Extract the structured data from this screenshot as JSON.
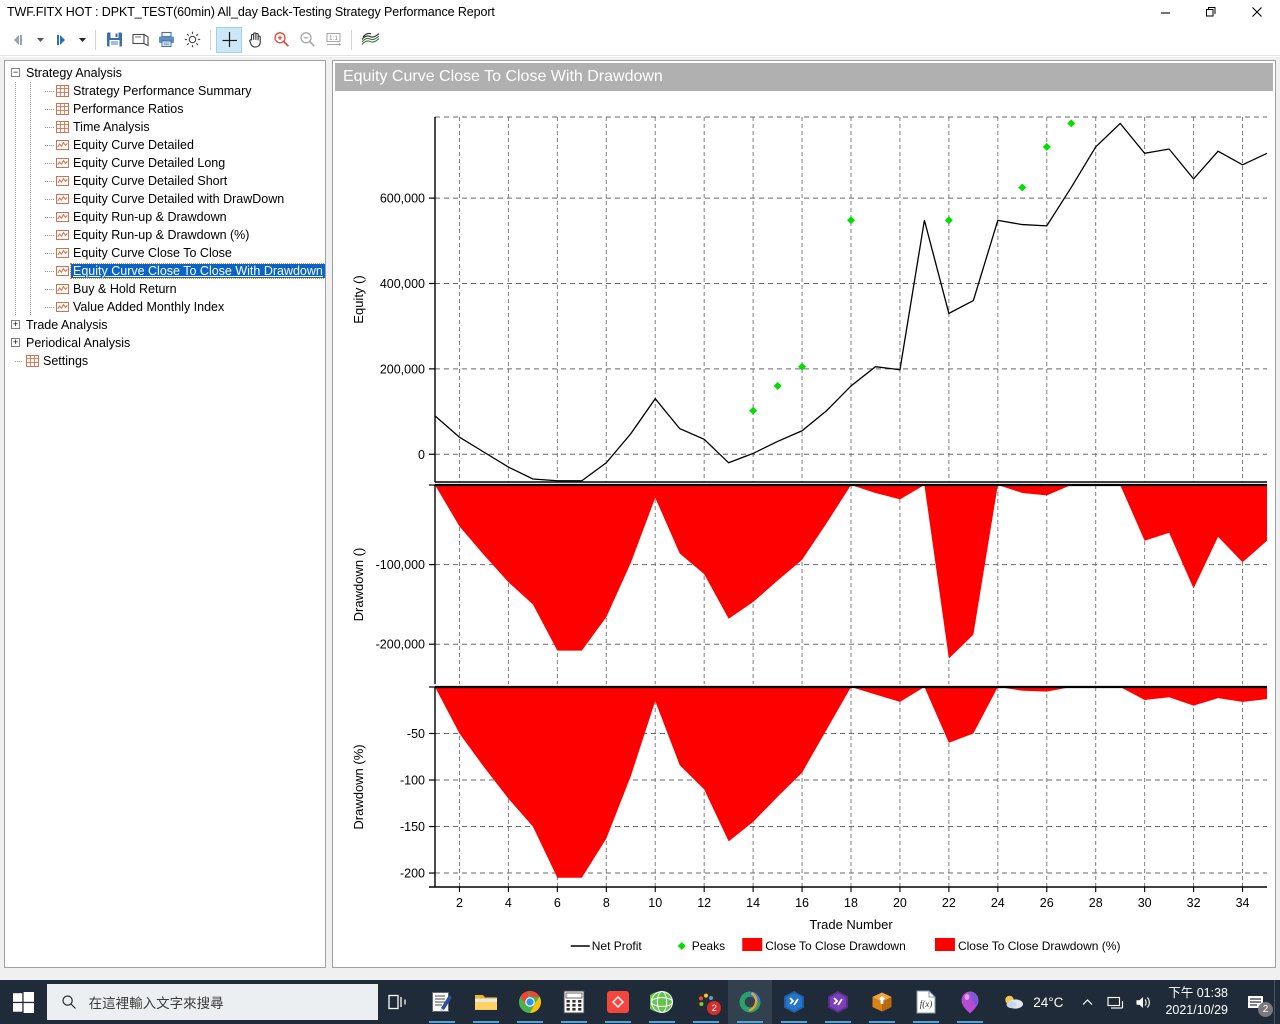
{
  "window": {
    "title": "TWF.FITX HOT : DPKT_TEST(60min) All_day Back-Testing Strategy Performance Report",
    "minimize_label": "—",
    "restore_label": "❐",
    "close_label": "✕"
  },
  "toolbar": {
    "items": [
      {
        "name": "nav-back-button",
        "glyph": "◀▏",
        "tip": "Back"
      },
      {
        "name": "nav-back-dropdown",
        "glyph": "▾",
        "tip": "Back history"
      },
      {
        "name": "nav-forward-button",
        "glyph": "▕▶",
        "tip": "Forward"
      },
      {
        "name": "nav-forward-dropdown",
        "glyph": "▾",
        "tip": "Forward history"
      },
      {
        "name": "save-button",
        "glyph": "save-icon",
        "tip": "Save"
      },
      {
        "name": "page-setup-button",
        "glyph": "page-setup-icon",
        "tip": "Page Setup"
      },
      {
        "name": "print-button",
        "glyph": "print-icon",
        "tip": "Print"
      },
      {
        "name": "settings-button",
        "glyph": "gear-icon",
        "tip": "Settings"
      },
      {
        "name": "crosshair-tool-button",
        "glyph": "crosshair-icon",
        "tip": "Crosshair",
        "active": true
      },
      {
        "name": "pan-tool-button",
        "glyph": "hand-icon",
        "tip": "Pan"
      },
      {
        "name": "zoom-in-button",
        "glyph": "zoom-in-icon",
        "tip": "Zoom In"
      },
      {
        "name": "zoom-out-button",
        "glyph": "zoom-out-icon",
        "tip": "Zoom Out"
      },
      {
        "name": "actual-size-button",
        "glyph": "one-to-one-icon",
        "tip": "1:1"
      },
      {
        "name": "chart-style-button",
        "glyph": "wave-icon",
        "tip": "Chart Style"
      }
    ]
  },
  "tree": {
    "nodes": [
      {
        "label": "Strategy Analysis",
        "level": 0,
        "icon": "none",
        "expander": "minus",
        "selected": false
      },
      {
        "label": "Strategy Performance Summary",
        "level": 1,
        "icon": "grid",
        "expander": "none",
        "selected": false
      },
      {
        "label": "Performance Ratios",
        "level": 1,
        "icon": "grid",
        "expander": "none",
        "selected": false
      },
      {
        "label": "Time Analysis",
        "level": 1,
        "icon": "grid",
        "expander": "none",
        "selected": false
      },
      {
        "label": "Equity Curve Detailed",
        "level": 1,
        "icon": "chart",
        "expander": "none",
        "selected": false
      },
      {
        "label": "Equity Curve Detailed Long",
        "level": 1,
        "icon": "chart",
        "expander": "none",
        "selected": false
      },
      {
        "label": "Equity Curve Detailed Short",
        "level": 1,
        "icon": "chart",
        "expander": "none",
        "selected": false
      },
      {
        "label": "Equity Curve Detailed with DrawDown",
        "level": 1,
        "icon": "chart",
        "expander": "none",
        "selected": false
      },
      {
        "label": "Equity Run-up & Drawdown",
        "level": 1,
        "icon": "chart",
        "expander": "none",
        "selected": false
      },
      {
        "label": "Equity Run-up & Drawdown (%)",
        "level": 1,
        "icon": "chart",
        "expander": "none",
        "selected": false
      },
      {
        "label": "Equity Curve Close To Close",
        "level": 1,
        "icon": "chart",
        "expander": "none",
        "selected": false
      },
      {
        "label": "Equity Curve Close To Close With Drawdown",
        "level": 1,
        "icon": "chart",
        "expander": "none",
        "selected": true
      },
      {
        "label": "Buy & Hold Return",
        "level": 1,
        "icon": "chart",
        "expander": "none",
        "selected": false
      },
      {
        "label": "Value Added Monthly Index",
        "level": 1,
        "icon": "chart",
        "expander": "none",
        "selected": false
      },
      {
        "label": "Trade Analysis",
        "level": 0,
        "icon": "none",
        "expander": "plus",
        "selected": false
      },
      {
        "label": "Periodical Analysis",
        "level": 0,
        "icon": "none",
        "expander": "plus",
        "selected": false
      },
      {
        "label": "Settings",
        "level": 0,
        "icon": "grid",
        "expander": "none",
        "selected": false
      }
    ]
  },
  "chart_data": {
    "type": "line",
    "title": "Equity Curve Close To Close With Drawdown",
    "xlabel": "Trade Number",
    "x": [
      1,
      2,
      3,
      4,
      5,
      6,
      7,
      8,
      9,
      10,
      11,
      12,
      13,
      14,
      15,
      16,
      17,
      18,
      19,
      20,
      21,
      22,
      23,
      24,
      25,
      26,
      27,
      28,
      29,
      30,
      31,
      32,
      33,
      34,
      35
    ],
    "xlim": [
      1,
      35
    ],
    "xticks": [
      2,
      4,
      6,
      8,
      10,
      12,
      14,
      16,
      18,
      20,
      22,
      24,
      26,
      28,
      30,
      32,
      34
    ],
    "grid": true,
    "legend_position": "bottom",
    "legend": [
      {
        "label": "Net Profit",
        "marker": "line",
        "color": "#000000"
      },
      {
        "label": "Peaks",
        "marker": "diamond",
        "color": "#00e000"
      },
      {
        "label": "Close To Close Drawdown",
        "marker": "area",
        "color": "#ff0000"
      },
      {
        "label": "Close To Close Drawdown (%)",
        "marker": "area",
        "color": "#ff0000"
      }
    ],
    "panels": [
      {
        "name": "equity",
        "ylabel": "Equity ()",
        "yticks": [
          0,
          200000,
          400000,
          600000
        ],
        "ytick_labels": [
          "0",
          "200,000",
          "400,000",
          "600,000"
        ],
        "ylim": [
          -65000,
          790000
        ],
        "series": [
          {
            "name": "Net Profit",
            "color": "#000000",
            "values": [
              90000,
              40000,
              5000,
              -30000,
              -58000,
              -62000,
              -62000,
              -20000,
              48000,
              130000,
              60000,
              35000,
              -20000,
              2000,
              30000,
              55000,
              102000,
              160000,
              205000,
              198000,
              548000,
              330000,
              360000,
              548000,
              538000,
              535000,
              625000,
              720000,
              775000,
              705000,
              715000,
              645000,
              710000,
              678000,
              705000
            ]
          },
          {
            "name": "Peaks",
            "color": "#00e000",
            "marker": "diamond",
            "points": [
              {
                "x": 14,
                "y": 102000
              },
              {
                "x": 15,
                "y": 160000
              },
              {
                "x": 16,
                "y": 205000
              },
              {
                "x": 18,
                "y": 548000
              },
              {
                "x": 22,
                "y": 548000
              },
              {
                "x": 25,
                "y": 625000
              },
              {
                "x": 26,
                "y": 720000
              },
              {
                "x": 27,
                "y": 775000
              }
            ]
          }
        ]
      },
      {
        "name": "drawdown-abs",
        "ylabel": "Drawdown ()",
        "yticks": [
          -100000,
          -200000
        ],
        "ytick_labels": [
          "-100,000",
          "-200,000"
        ],
        "ylim": [
          -250000,
          0
        ],
        "series": [
          {
            "name": "Close To Close Drawdown",
            "color": "#ff0000",
            "values": [
              0,
              -52000,
              -88000,
              -122000,
              -150000,
              -208000,
              -208000,
              -166000,
              -98000,
              -16000,
              -86000,
              -112000,
              -168000,
              -147000,
              -120000,
              -94000,
              -48000,
              0,
              -10000,
              -18000,
              0,
              -218000,
              -188000,
              0,
              -10000,
              -13000,
              0,
              0,
              0,
              -70000,
              -60000,
              -130000,
              -65000,
              -97000,
              -70000
            ]
          }
        ]
      },
      {
        "name": "drawdown-pct",
        "ylabel": "Drawdown (%)",
        "yticks": [
          -50,
          -100,
          -150,
          -200
        ],
        "ytick_labels": [
          "-50",
          "-100",
          "-150",
          "-200"
        ],
        "ylim": [
          -215,
          0
        ],
        "series": [
          {
            "name": "Close To Close Drawdown (%)",
            "color": "#ff0000",
            "values": [
              0,
              -50,
              -86,
              -120,
              -150,
              -205,
              -205,
              -163,
              -96,
              -15,
              -84,
              -110,
              -166,
              -145,
              -118,
              -92,
              -46,
              0,
              -8,
              -16,
              0,
              -60,
              -50,
              0,
              -4,
              -5,
              0,
              0,
              0,
              -14,
              -11,
              -20,
              -12,
              -16,
              -13
            ]
          }
        ]
      }
    ]
  },
  "taskbar": {
    "start_label": "start-button",
    "search_placeholder": "在這裡輸入文字來搜尋",
    "apps": [
      {
        "name": "task-view-icon",
        "label": "Task View"
      },
      {
        "name": "editor-app-icon",
        "label": "Editor"
      },
      {
        "name": "file-explorer-icon",
        "label": "File Explorer"
      },
      {
        "name": "chrome-icon",
        "label": "Google Chrome"
      },
      {
        "name": "calculator-icon",
        "label": "Calculator"
      },
      {
        "name": "red-diamond-app-icon",
        "label": "App"
      },
      {
        "name": "globe-browser-icon",
        "label": "Browser"
      },
      {
        "name": "palette-app-icon",
        "label": "Palette",
        "badge": "2"
      },
      {
        "name": "multicharts-icon",
        "label": "MultiCharts",
        "active": true
      },
      {
        "name": "vs-blue-icon",
        "label": "Visual Studio Blue"
      },
      {
        "name": "vs-purple-icon",
        "label": "Visual Studio Purple"
      },
      {
        "name": "package-icon",
        "label": "Package"
      },
      {
        "name": "formula-doc-icon",
        "label": "Formula Document"
      },
      {
        "name": "balloon-icon",
        "label": "Balloon"
      }
    ],
    "tray": {
      "weather_temp": "24°C",
      "chevron": "ⱏ",
      "network_icon": "network-icon",
      "volume_icon": "volume-icon",
      "time": "下午 01:38",
      "date": "2021/10/29",
      "notification_badge": "2"
    }
  }
}
